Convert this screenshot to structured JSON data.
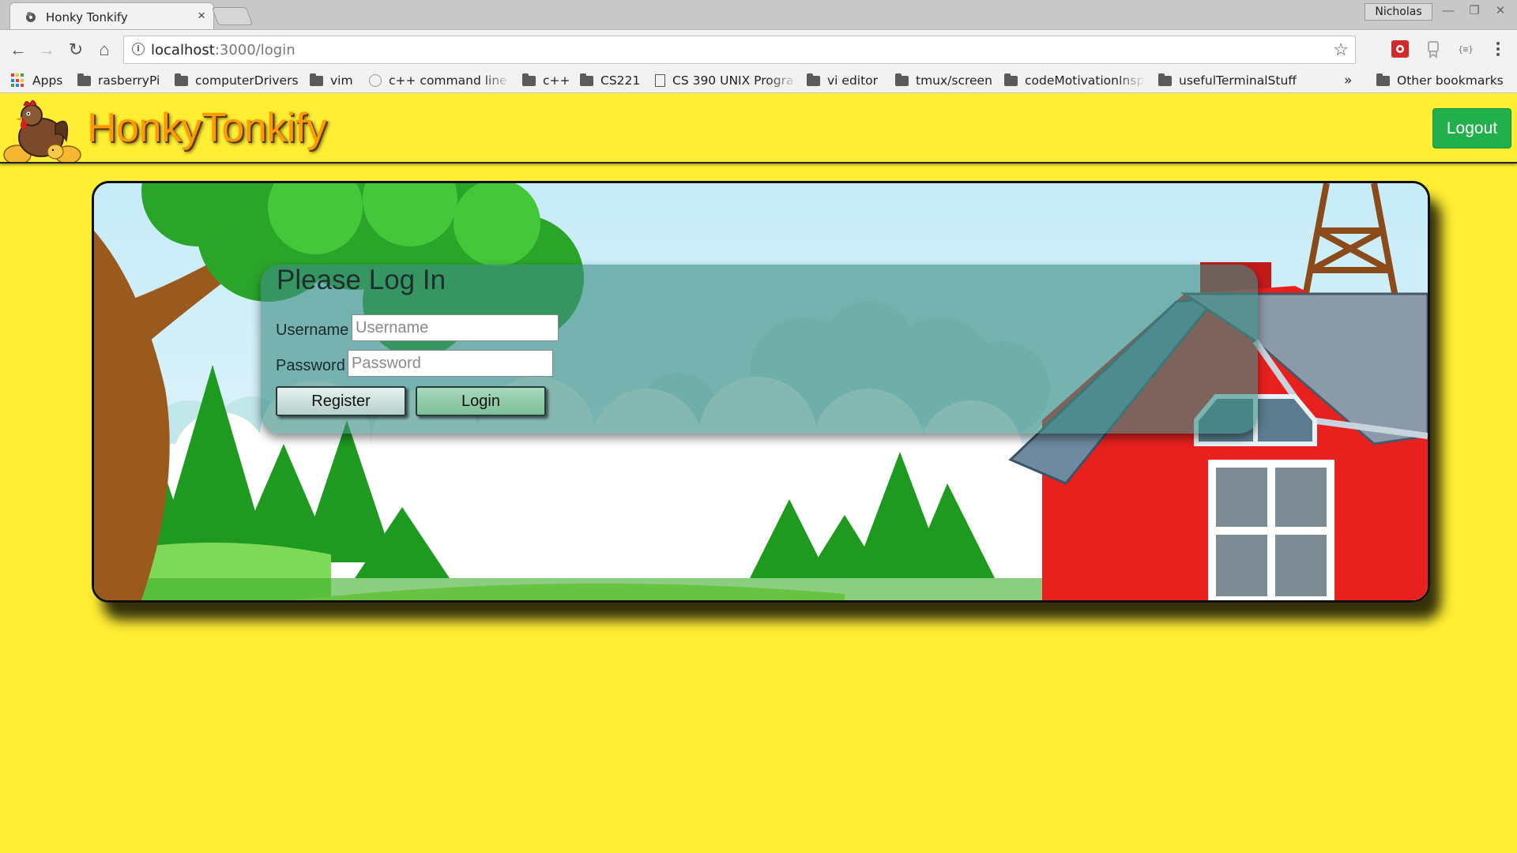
{
  "browser": {
    "tab_title": "Honky Tonkify",
    "tab_close": "×",
    "profile_name": "Nicholas",
    "url_host": "localhost",
    "url_path": ":3000/login",
    "nav": {
      "back": "←",
      "forward": "→",
      "reload": "↻",
      "home": "⌂"
    },
    "window_controls": [
      "—",
      "❐",
      "✕"
    ],
    "bookmarks": [
      {
        "label": "Apps",
        "icon": "apps-grid-icon"
      },
      {
        "label": "rasberryPi",
        "icon": "folder-icon"
      },
      {
        "label": "computerDrivers",
        "icon": "folder-icon"
      },
      {
        "label": "vim",
        "icon": "folder-icon"
      },
      {
        "label": "c++ command line V",
        "icon": "globe-icon"
      },
      {
        "label": "c++",
        "icon": "folder-icon"
      },
      {
        "label": "CS221",
        "icon": "folder-icon"
      },
      {
        "label": "CS 390 UNIX Progra",
        "icon": "document-icon"
      },
      {
        "label": "vi editor",
        "icon": "folder-icon"
      },
      {
        "label": "tmux/screen",
        "icon": "folder-icon"
      },
      {
        "label": "codeMotivationInsp",
        "icon": "folder-icon"
      },
      {
        "label": "usefulTerminalStuff",
        "icon": "folder-icon"
      }
    ],
    "bookmarks_overflow": "»",
    "other_bookmarks": "Other bookmarks"
  },
  "site": {
    "brand": "HonkyTonkify",
    "logout_label": "Logout"
  },
  "login": {
    "title": "Please Log In",
    "username_label": "Username",
    "username_placeholder": "Username",
    "password_label": "Password",
    "password_placeholder": "Password",
    "register_label": "Register",
    "login_label": "Login"
  },
  "colors": {
    "page_background": "#ffee33",
    "brand_text": "#ff9b00",
    "logout_button": "#22b04c",
    "login_panel": "#3c8c82",
    "barn_red": "#e8201e"
  }
}
